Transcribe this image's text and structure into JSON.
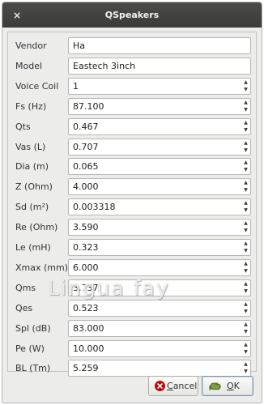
{
  "window": {
    "title": "QSpeakers",
    "close_glyph": "×"
  },
  "fields": [
    {
      "label": "Vendor",
      "value": "Ha",
      "spin": false
    },
    {
      "label": "Model",
      "value": "Eastech 3inch",
      "spin": false
    },
    {
      "label": "Voice Coil",
      "value": "1",
      "spin": true
    },
    {
      "label": "Fs (Hz)",
      "value": "87.100",
      "spin": true
    },
    {
      "label": "Qts",
      "value": "0.467",
      "spin": true
    },
    {
      "label": "Vas (L)",
      "value": "0.707",
      "spin": true
    },
    {
      "label": "Dia (m)",
      "value": "0.065",
      "spin": true
    },
    {
      "label": "Z (Ohm)",
      "value": "4.000",
      "spin": true
    },
    {
      "label": "Sd (m²)",
      "value": "0.003318",
      "spin": true
    },
    {
      "label": "Re (Ohm)",
      "value": "3.590",
      "spin": true
    },
    {
      "label": "Le (mH)",
      "value": "0.323",
      "spin": true
    },
    {
      "label": "Xmax (mm)",
      "value": "6.000",
      "spin": true
    },
    {
      "label": "Qms",
      "value": "3.737",
      "spin": true
    },
    {
      "label": "Qes",
      "value": "0.523",
      "spin": true
    },
    {
      "label": "Spl (dB)",
      "value": "83.000",
      "spin": true
    },
    {
      "label": "Pe (W)",
      "value": "10.000",
      "spin": true
    },
    {
      "label": "BL (Tm)",
      "value": "5.259",
      "spin": true
    }
  ],
  "buttons": {
    "cancel": {
      "mnemonic": "C",
      "rest": "ancel",
      "icon": "cancel-icon",
      "icon_color": "#cc0000"
    },
    "ok": {
      "mnemonic": "O",
      "rest": "K",
      "icon": "ok-hand-icon",
      "icon_color": "#6a8a3a"
    }
  },
  "watermark": "Lingua fay"
}
